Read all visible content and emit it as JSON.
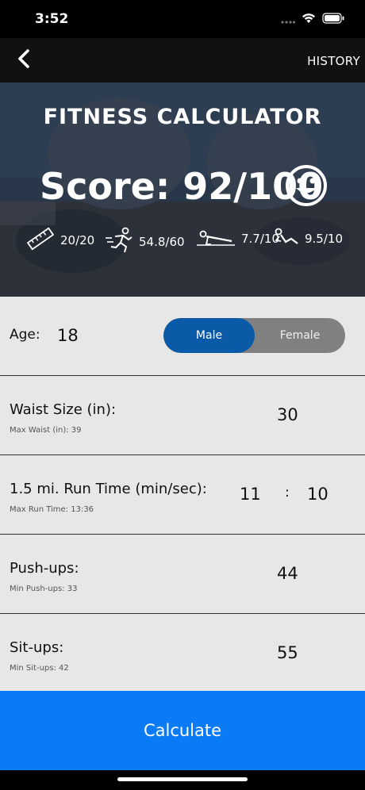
{
  "status": {
    "time": "3:52"
  },
  "nav": {
    "history_label": "HISTORY"
  },
  "hero": {
    "title": "FITNESS CALCULATOR",
    "score": "Score: 92/100",
    "metrics": [
      {
        "icon": "ruler-icon",
        "value": "20/20"
      },
      {
        "icon": "runner-icon",
        "value": "54.8/60"
      },
      {
        "icon": "pushup-icon",
        "value": "7.7/10"
      },
      {
        "icon": "situp-icon",
        "value": "9.5/10"
      }
    ]
  },
  "form": {
    "age": {
      "label": "Age:",
      "value": "18"
    },
    "gender": {
      "male": "Male",
      "female": "Female",
      "selected": "Male"
    },
    "waist": {
      "label": "Waist Size (in):",
      "sub": "Max Waist (in): 39",
      "value": "30"
    },
    "run": {
      "label": "1.5 mi. Run Time (min/sec):",
      "sub": "Max Run Time: 13:36",
      "minutes": "11",
      "separator": ":",
      "seconds": "10"
    },
    "pushups": {
      "label": "Push-ups:",
      "sub": "Min Push-ups: 33",
      "value": "44"
    },
    "situps": {
      "label": "Sit-ups:",
      "sub": "Min Sit-ups: 42",
      "value": "55"
    }
  },
  "calculate_label": "Calculate",
  "colors": {
    "accent": "#0a7bf5",
    "toggle_selected": "#0a5aa8",
    "toggle_bg": "#808080",
    "row_bg": "#e7e7e7"
  }
}
